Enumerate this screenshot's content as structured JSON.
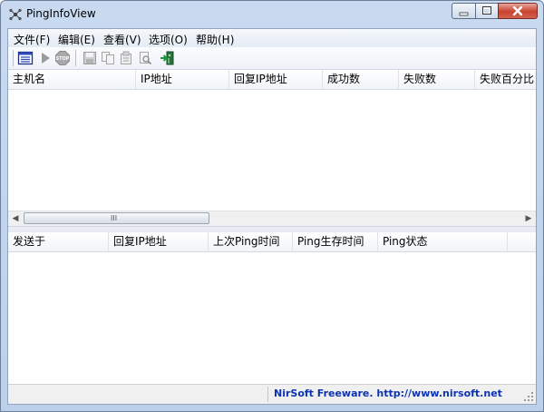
{
  "window": {
    "title": "PingInfoView"
  },
  "menu": [
    {
      "label": "文件(F)"
    },
    {
      "label": "编辑(E)"
    },
    {
      "label": "查看(V)"
    },
    {
      "label": "选项(O)"
    },
    {
      "label": "帮助(H)"
    }
  ],
  "toolbar": {
    "icons": [
      "ping-options-icon",
      "start-icon",
      "stop-icon",
      "save-icon",
      "copy-icon",
      "properties-icon",
      "find-icon",
      "exit-icon"
    ]
  },
  "upper_list": {
    "columns": [
      "主机名",
      "IP地址",
      "回复IP地址",
      "成功数",
      "失败数",
      "失败百分比"
    ],
    "rows": []
  },
  "lower_list": {
    "columns": [
      "发送于",
      "回复IP地址",
      "上次Ping时间",
      "Ping生存时间",
      "Ping状态"
    ],
    "rows": []
  },
  "scrollbar": {
    "grip": "III"
  },
  "status": {
    "link": "NirSoft Freeware.  http://www.nirsoft.net"
  },
  "colors": {
    "link": "#0b33b4",
    "titlebar": "#c9daf0",
    "close_button": "#c8432f"
  }
}
